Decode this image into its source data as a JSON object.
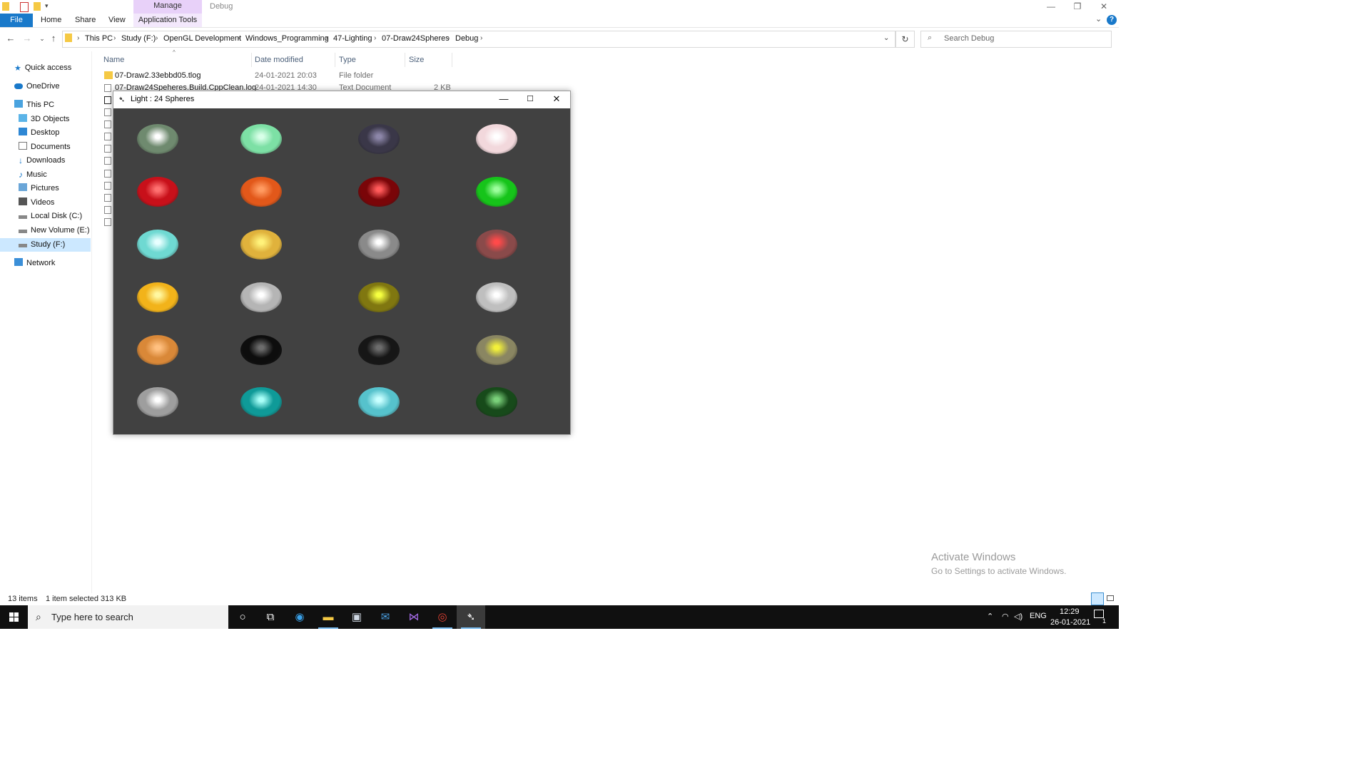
{
  "window": {
    "manage_tab": "Manage",
    "folder_title": "Debug",
    "ribbon_tabs": [
      "File",
      "Home",
      "Share",
      "View",
      "Application Tools"
    ]
  },
  "address": {
    "crumbs": [
      "This PC",
      "Study (F:)",
      "OpenGL Development",
      "Windows_Programming",
      "47-Lighting",
      "07-Draw24Spheres",
      "Debug"
    ],
    "search_placeholder": "Search Debug"
  },
  "navpane": {
    "items": [
      {
        "label": "Quick access",
        "icon": "star-icon"
      },
      {
        "label": "OneDrive",
        "icon": "cloud-icon"
      },
      {
        "label": "This PC",
        "icon": "computer-icon"
      },
      {
        "label": "3D Objects",
        "icon": "cube-icon"
      },
      {
        "label": "Desktop",
        "icon": "desktop-icon"
      },
      {
        "label": "Documents",
        "icon": "document-icon"
      },
      {
        "label": "Downloads",
        "icon": "download-icon"
      },
      {
        "label": "Music",
        "icon": "music-icon"
      },
      {
        "label": "Pictures",
        "icon": "pictures-icon"
      },
      {
        "label": "Videos",
        "icon": "video-icon"
      },
      {
        "label": "Local Disk (C:)",
        "icon": "drive-icon"
      },
      {
        "label": "New Volume (E:)",
        "icon": "drive-icon"
      },
      {
        "label": "Study (F:)",
        "icon": "drive-icon"
      },
      {
        "label": "Network",
        "icon": "network-icon"
      }
    ]
  },
  "filelist": {
    "columns": [
      "Name",
      "Date modified",
      "Type",
      "Size"
    ],
    "rows": [
      {
        "name": "07-Draw2.33ebbd05.tlog",
        "date": "24-01-2021 20:03",
        "type": "File folder",
        "size": ""
      },
      {
        "name": "07-Draw24Speheres.Build.CppClean.log",
        "date": "24-01-2021 14:30",
        "type": "Text Document",
        "size": "2 KB"
      }
    ]
  },
  "app_window": {
    "title": "Light : 24 Spheres",
    "canvas_bg": "#414141",
    "spheres": [
      [
        "#6f8a6f",
        "#7de0a5",
        "#3a3748",
        "#f2d8dc"
      ],
      [
        "#c8101a",
        "#e2581a",
        "#7a0508",
        "#16c41a"
      ],
      [
        "#6fd9d2",
        "#e0b23c",
        "#8a8a8a",
        "#8a4a4a"
      ],
      [
        "#f2b31a",
        "#b5b5b5",
        "#807710",
        "#bfbfbf"
      ],
      [
        "#d98838",
        "#0d0d0d",
        "#161616",
        "#8a8662"
      ],
      [
        "#9e9e9e",
        "#0f9a98",
        "#56c2cc",
        "#174a1a"
      ]
    ],
    "highlights": [
      [
        "#ffffff",
        "#d8ffe8",
        "#8c86a8",
        "#ffffff"
      ],
      [
        "#ff7070",
        "#ff9a60",
        "#ff5a5a",
        "#9cff9c"
      ],
      [
        "#e8ffff",
        "#fff27a",
        "#ffffff",
        "#ff4a4a"
      ],
      [
        "#fff7a0",
        "#ffffff",
        "#f5ff40",
        "#ffffff"
      ],
      [
        "#ffc080",
        "#6c6c6c",
        "#6c6c6c",
        "#f2f03a"
      ],
      [
        "#ffffff",
        "#a8fff8",
        "#c8ffff",
        "#7ad07a"
      ]
    ]
  },
  "status": {
    "items": "13 items",
    "selected": "1 item selected  313 KB"
  },
  "watermark": {
    "line1": "Activate Windows",
    "line2": "Go to Settings to activate Windows."
  },
  "taskbar": {
    "search_placeholder": "Type here to search",
    "lang": "ENG",
    "time": "12:29",
    "date": "26-01-2021",
    "notification_count": "1"
  }
}
